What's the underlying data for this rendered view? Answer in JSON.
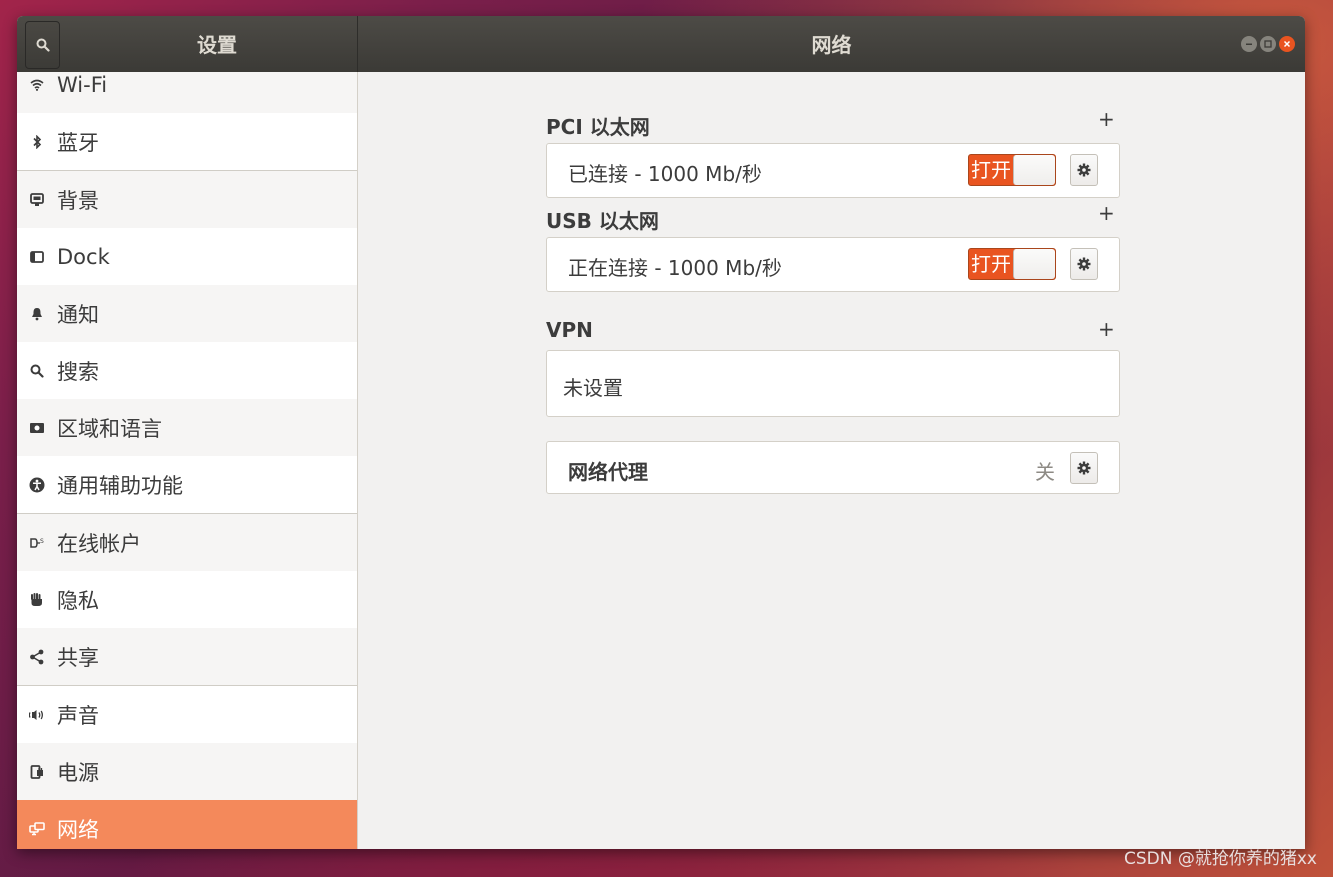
{
  "window": {
    "left_title": "设置",
    "right_title": "网络"
  },
  "sidebar": {
    "items": [
      {
        "label": "Wi-Fi",
        "icon": "wifi-icon"
      },
      {
        "label": "蓝牙",
        "icon": "bluetooth-icon"
      },
      {
        "label": "背景",
        "icon": "background-icon"
      },
      {
        "label": "Dock",
        "icon": "dock-icon"
      },
      {
        "label": "通知",
        "icon": "bell-icon"
      },
      {
        "label": "搜索",
        "icon": "search-icon"
      },
      {
        "label": "区域和语言",
        "icon": "region-language-icon"
      },
      {
        "label": "通用辅助功能",
        "icon": "accessibility-icon"
      },
      {
        "label": "在线帐户",
        "icon": "online-accounts-icon"
      },
      {
        "label": "隐私",
        "icon": "privacy-hand-icon"
      },
      {
        "label": "共享",
        "icon": "share-icon"
      },
      {
        "label": "声音",
        "icon": "speaker-icon"
      },
      {
        "label": "电源",
        "icon": "power-icon"
      },
      {
        "label": "网络",
        "icon": "network-icon",
        "active": true
      }
    ]
  },
  "network": {
    "pci": {
      "title": "PCI 以太网",
      "status": "已连接 - 1000 Mb/秒",
      "toggle_label": "打开"
    },
    "usb": {
      "title": "USB 以太网",
      "status": "正在连接 - 1000 Mb/秒",
      "toggle_label": "打开"
    },
    "vpn": {
      "title": "VPN",
      "status": "未设置"
    },
    "proxy": {
      "label": "网络代理",
      "value": "关"
    },
    "add_symbol": "+"
  },
  "colors": {
    "accent": "#e95420",
    "active_row": "#f4895b"
  },
  "watermark": "CSDN @就抢你养的猪xx"
}
